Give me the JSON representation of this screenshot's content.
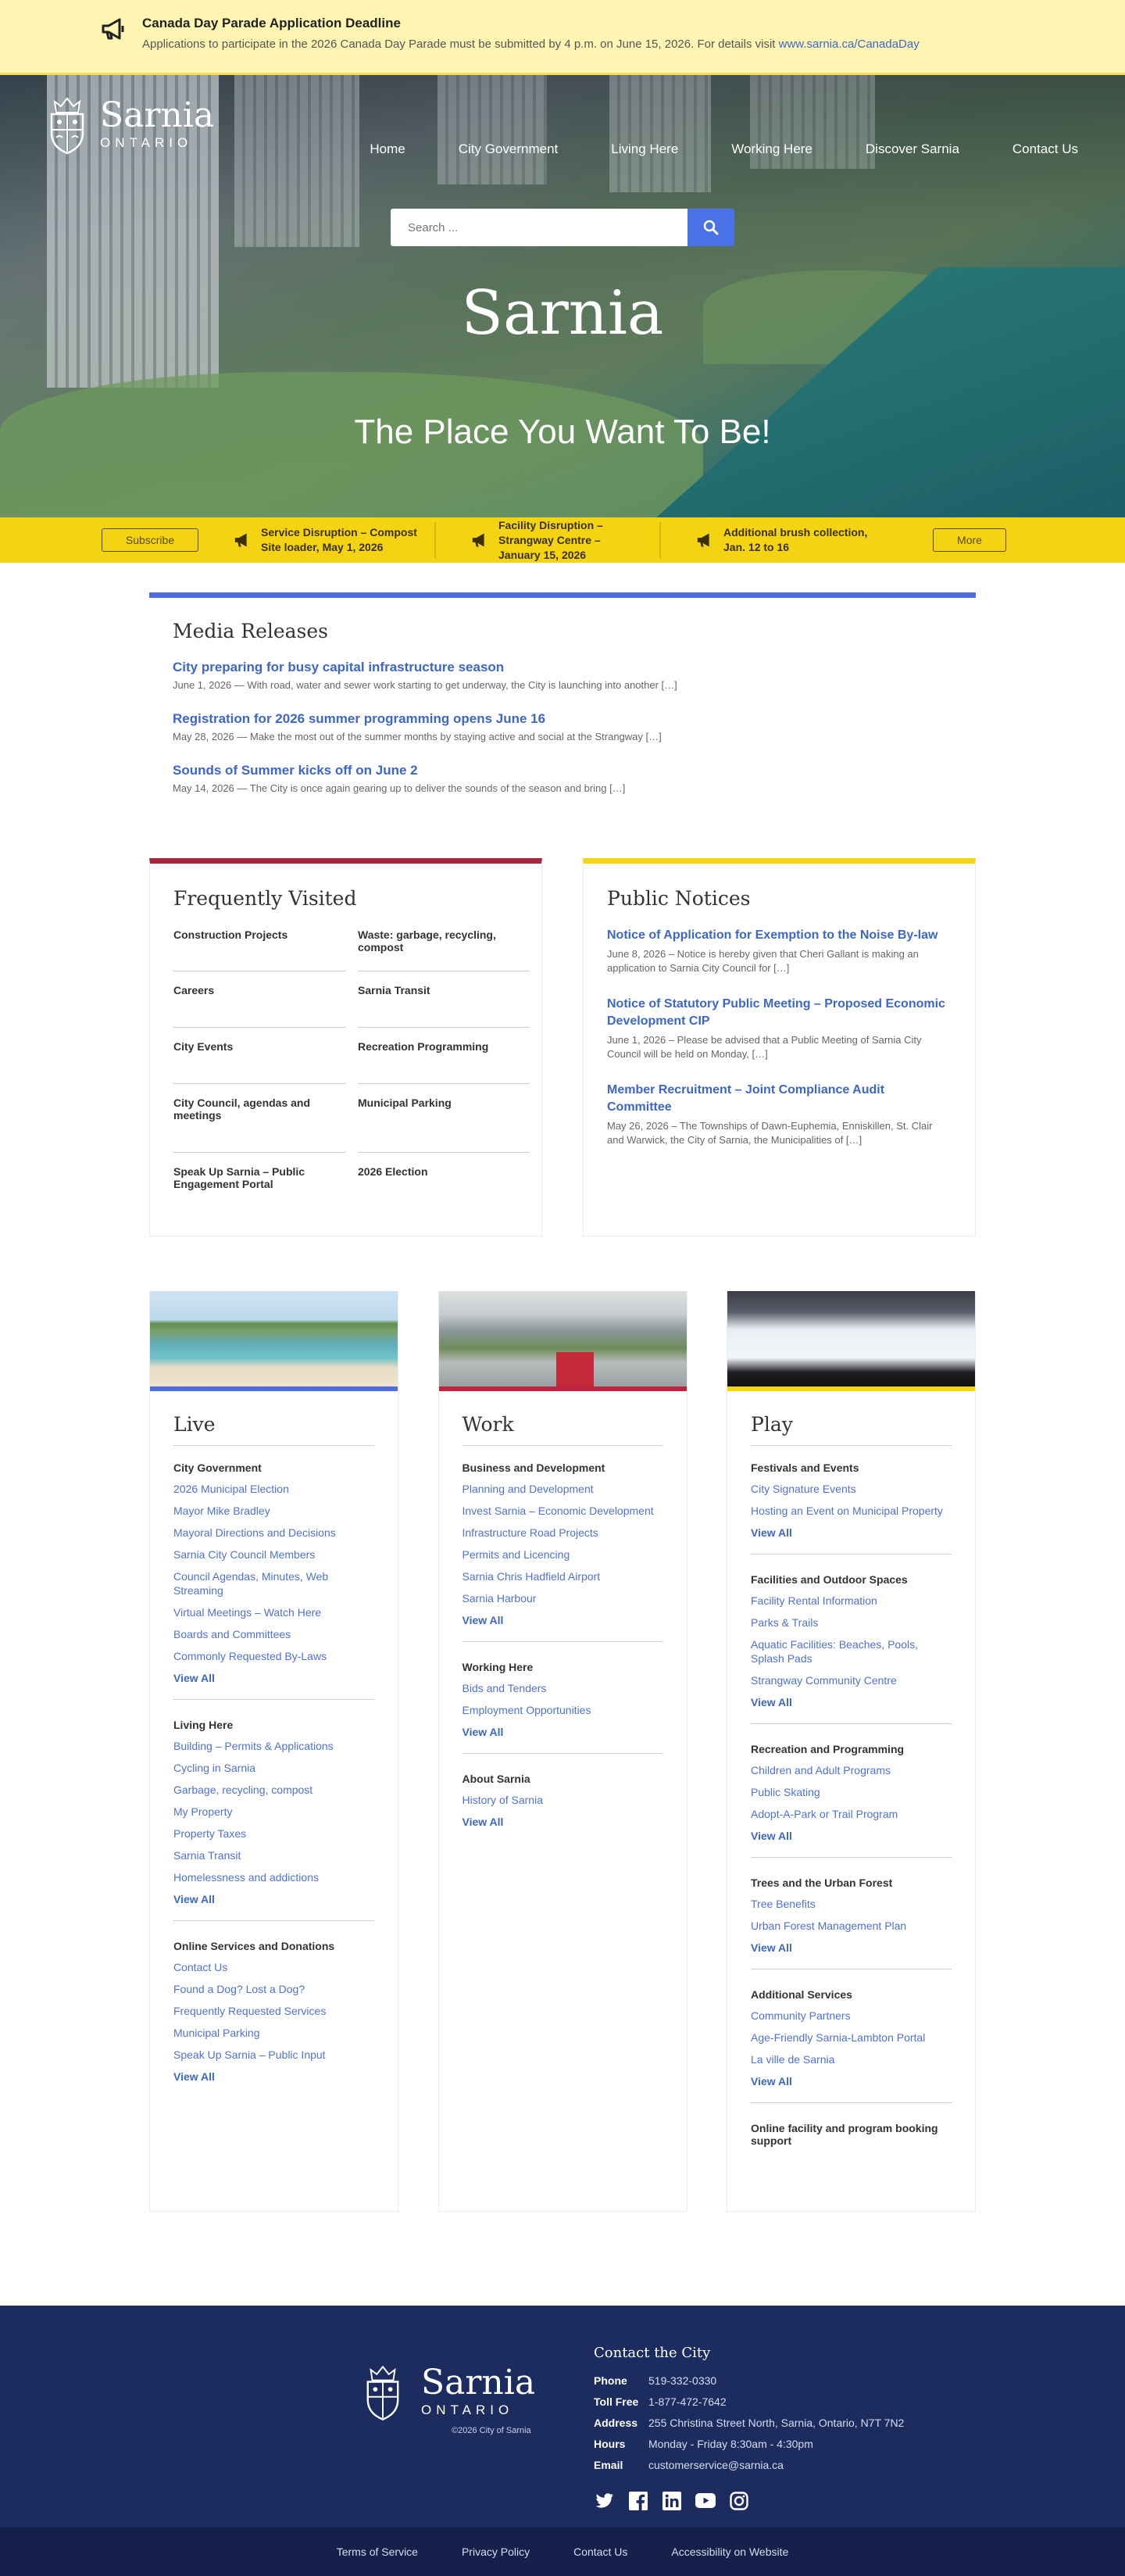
{
  "alert": {
    "title": "Canada Day Parade Application Deadline",
    "body": "Applications to participate in the 2026 Canada Day Parade must be submitted by 4 p.m. on June 15, 2026. For details visit ",
    "link": "www.sarnia.ca/CanadaDay",
    "icon": "megaphone-icon"
  },
  "logo": {
    "name": "Sarnia",
    "sub": "ONTARIO"
  },
  "nav": [
    "Home",
    "City Government",
    "Living Here",
    "Working Here",
    "Discover Sarnia",
    "Contact Us"
  ],
  "search": {
    "placeholder": "Search ...",
    "icon": "search-icon"
  },
  "hero": {
    "title": "Sarnia",
    "subtitle": "The Place You Want To Be!"
  },
  "ticker": {
    "subscribe": "Subscribe",
    "more": "More",
    "items": [
      "Service Disruption – Compost Site loader, May 1, 2026",
      "Facility Disruption – Strangway Centre – January 15, 2026",
      "Additional brush collection, Jan. 12 to 16"
    ]
  },
  "media": {
    "title": "Media Releases",
    "items": [
      {
        "title": "City preparing for busy capital infrastructure season",
        "meta": "June 1, 2026 — With road, water and sewer work starting to get underway, the City is launching into another […]"
      },
      {
        "title": "Registration for 2026 summer programming opens June 16",
        "meta": "May 28, 2026 — Make the most out of the summer months by staying active and social at the Strangway […]"
      },
      {
        "title": "Sounds of Summer kicks off on June 2",
        "meta": "May 14, 2026 — The City is once again gearing up to deliver the sounds of the season and bring […]"
      }
    ]
  },
  "frequent": {
    "title": "Frequently Visited",
    "left": [
      "Construction Projects",
      "Careers",
      "City Events",
      "City Council, agendas and meetings",
      "Speak Up Sarnia – Public Engagement Portal"
    ],
    "right": [
      "Waste: garbage, recycling, compost",
      "Sarnia Transit",
      "Recreation Programming",
      "Municipal Parking",
      "2026 Election"
    ]
  },
  "notices": {
    "title": "Public Notices",
    "items": [
      {
        "title": "Notice of Application for Exemption to the Noise By-law",
        "meta": "June 8, 2026 – Notice is hereby given that Cheri Gallant is making an application to Sarnia City Council for […]"
      },
      {
        "title": "Notice of Statutory Public Meeting – Proposed Economic Development CIP",
        "meta": "June 1, 2026 – Please be advised that a Public Meeting of Sarnia City Council will be held on Monday, […]"
      },
      {
        "title": "Member Recruitment – Joint Compliance Audit Committee",
        "meta": "May 26, 2026 – The Townships of Dawn-Euphemia, Enniskillen, St. Clair and Warwick, the City of Sarnia, the Municipalities of […]"
      }
    ]
  },
  "live": {
    "title": "Live",
    "color": "#4f6cde",
    "groups": [
      {
        "heading": "City Government",
        "links": [
          "2026 Municipal Election",
          "Mayor Mike Bradley",
          "Mayoral Directions and Decisions",
          "Sarnia City Council Members",
          "Council Agendas, Minutes, Web Streaming",
          "Virtual Meetings – Watch Here",
          "Boards and Committees",
          "Commonly Requested By-Laws"
        ],
        "view": "View All"
      },
      {
        "heading": "Living Here",
        "links": [
          "Building – Permits & Applications",
          "Cycling in Sarnia",
          "Garbage, recycling, compost",
          "My Property",
          "Property Taxes",
          "Sarnia Transit",
          "Homelessness and addictions"
        ],
        "view": "View All"
      },
      {
        "heading": "Online Services and Donations",
        "links": [
          "Contact Us",
          "Found a Dog? Lost a Dog?",
          "Frequently Requested Services",
          "Municipal Parking",
          "Speak Up Sarnia – Public Input"
        ],
        "view": "View All"
      }
    ]
  },
  "work": {
    "title": "Work",
    "color": "#c0243e",
    "groups": [
      {
        "heading": "Business and Development",
        "links": [
          "Planning and Development",
          "Invest Sarnia – Economic Development",
          "Infrastructure Road Projects",
          "Permits and Licencing",
          "Sarnia Chris Hadfield Airport",
          "Sarnia Harbour"
        ],
        "view": "View All"
      },
      {
        "heading": "Working Here",
        "links": [
          "Bids and Tenders",
          "Employment Opportunities"
        ],
        "view": "View All"
      },
      {
        "heading": "About Sarnia",
        "links": [
          "History of Sarnia"
        ],
        "view": "View All"
      }
    ]
  },
  "play": {
    "title": "Play",
    "color": "#f2d60f",
    "groups": [
      {
        "heading": "Festivals and Events",
        "links": [
          "City Signature Events",
          "Hosting an Event on Municipal Property"
        ],
        "view": "View All"
      },
      {
        "heading": "Facilities and Outdoor Spaces",
        "links": [
          "Facility Rental Information",
          "Parks & Trails",
          "Aquatic Facilities: Beaches, Pools, Splash Pads",
          "Strangway Community Centre"
        ],
        "view": "View All"
      },
      {
        "heading": "Recreation and Programming",
        "links": [
          "Children and Adult Programs",
          "Public Skating",
          "Adopt-A-Park or Trail Program"
        ],
        "view": "View All"
      },
      {
        "heading": "Trees and the Urban Forest",
        "links": [
          "Tree Benefits",
          "Urban Forest Management Plan"
        ],
        "view": "View All"
      },
      {
        "heading": "Additional Services",
        "links": [
          "Community Partners",
          "Age-Friendly Sarnia-Lambton Portal",
          "La ville de Sarnia"
        ],
        "view": "View All"
      },
      {
        "heading": "Online facility and program booking support",
        "links": [],
        "view": ""
      }
    ]
  },
  "footer": {
    "copyright": "©2026 City of Sarnia",
    "contact_title": "Contact the City",
    "rows": [
      {
        "label": "Phone",
        "value": "519-332-0330"
      },
      {
        "label": "Toll Free",
        "value": "1-877-472-7642"
      },
      {
        "label": "Address",
        "value": "255 Christina Street North, Sarnia, Ontario, N7T 7N2"
      },
      {
        "label": "Hours",
        "value": "Monday - Friday 8:30am - 4:30pm"
      },
      {
        "label": "Email",
        "value": "customerservice@sarnia.ca"
      }
    ],
    "social": [
      "twitter-icon",
      "facebook-icon",
      "linkedin-icon",
      "youtube-icon",
      "instagram-icon"
    ],
    "links": [
      "Terms of Service",
      "Privacy Policy",
      "Contact Us",
      "Accessibility on Website"
    ]
  }
}
